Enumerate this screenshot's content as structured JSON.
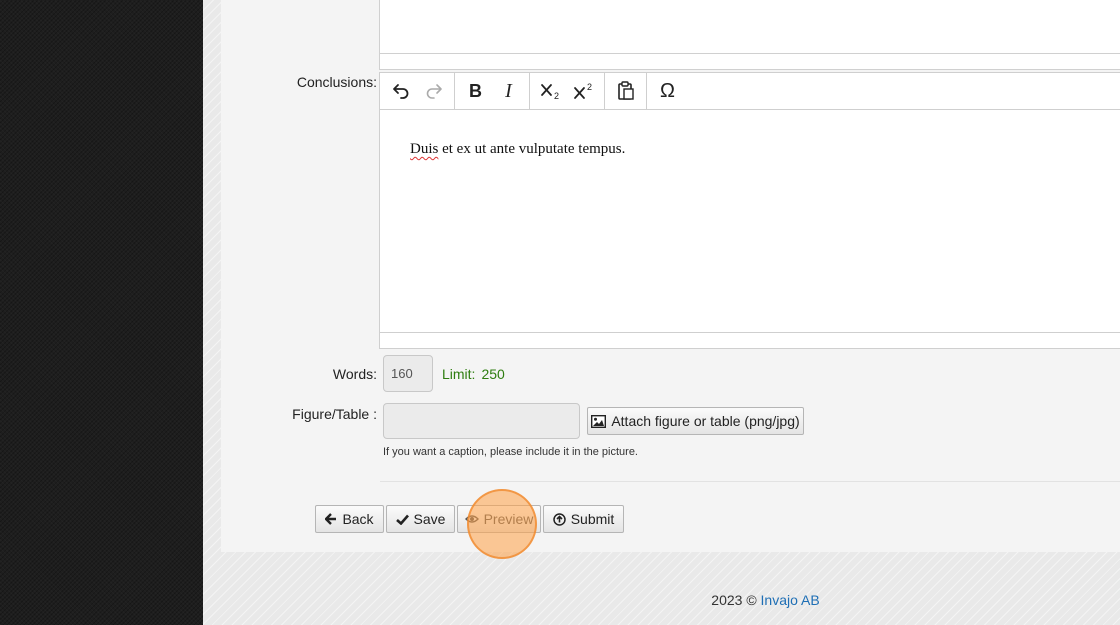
{
  "form": {
    "conclusions_label": "Conclusions:",
    "conclusions_text_word1": "Duis",
    "conclusions_text_rest": " et ex ut ante vulputate tempus.",
    "words_label": "Words:",
    "words_value": "160",
    "limit_label": "Limit:",
    "limit_value": "250",
    "figure_label": "Figure/Table :",
    "attach_label": "Attach figure or table (png/jpg)",
    "caption_hint": "If you want a caption, please include it in the picture."
  },
  "toolbar": {
    "undo_icon": "undo-icon",
    "redo_icon": "redo-icon",
    "bold_label": "B",
    "italic_label": "I",
    "subscript_icon": "subscript-icon",
    "superscript_icon": "superscript-icon",
    "paste_icon": "paste-icon",
    "special_char_label": "Ω"
  },
  "actions": {
    "back_label": "Back",
    "save_label": "Save",
    "preview_label": "Preview",
    "submit_label": "Submit"
  },
  "footer": {
    "copyright": "2023 ©",
    "company": "Invajo AB"
  },
  "colors": {
    "limit_green": "#2e7d10",
    "link_blue": "#1f6fb5",
    "click_highlight": "#ffa046"
  }
}
